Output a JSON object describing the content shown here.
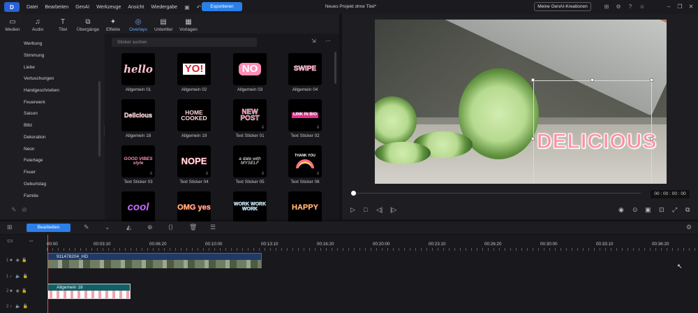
{
  "app": {
    "logo_text": "D",
    "menu": [
      "Datei",
      "Bearbeiten",
      "GenAI",
      "Werkzeuge",
      "Ansicht",
      "Wiedergabe"
    ],
    "export_label": "Exportieren",
    "project_title": "Neues Projekt ohne Titel*",
    "genai_button": "Meine GenAI-Kreationen"
  },
  "tabs": [
    {
      "label": "Medien",
      "icon": "folder-icon"
    },
    {
      "label": "Audio",
      "icon": "music-icon"
    },
    {
      "label": "Titel",
      "icon": "title-icon"
    },
    {
      "label": "Übergänge",
      "icon": "transition-icon"
    },
    {
      "label": "Effekte",
      "icon": "effects-icon"
    },
    {
      "label": "Overlays",
      "icon": "overlay-icon",
      "active": true
    },
    {
      "label": "Untertitel",
      "icon": "subtitle-icon"
    },
    {
      "label": "Vorlagen",
      "icon": "template-icon"
    }
  ],
  "categories": [
    "Werbung",
    "Stimmung",
    "Liebe",
    "Vertuschungen",
    "Handgeschrieben",
    "Feuerwerk",
    "Saison",
    "Blitz",
    "Dekoration",
    "Neon",
    "Feiertage",
    "Feuer",
    "Geburtstag",
    "Familie"
  ],
  "search": {
    "placeholder": "Sticker suchen"
  },
  "stickers": [
    {
      "label": "Allgemein 01",
      "art": "hello"
    },
    {
      "label": "Allgemein 02",
      "art": "YO!"
    },
    {
      "label": "Allgemein 03",
      "art": "NO"
    },
    {
      "label": "Allgemein 04",
      "art": "SWIPE"
    },
    {
      "label": "Allgemein 18",
      "art": "Delicious"
    },
    {
      "label": "Allgemein 19",
      "art": "HOME COOKED"
    },
    {
      "label": "Text Sticker 01",
      "art": "NEW POST"
    },
    {
      "label": "Text Sticker 02",
      "art": "LINK IN BIO"
    },
    {
      "label": "Text Sticker 03",
      "art": "GOOD VIBES style"
    },
    {
      "label": "Text Sticker 04",
      "art": "NOPE"
    },
    {
      "label": "Text Sticker 05",
      "art": "a date with MYSELF"
    },
    {
      "label": "Text Sticker 06",
      "art": "THANK YOU"
    },
    {
      "label": "",
      "art": "cool"
    },
    {
      "label": "",
      "art": "OMG yes"
    },
    {
      "label": "",
      "art": "WORK WORK WORK"
    },
    {
      "label": "",
      "art": "HAPPY"
    }
  ],
  "preview": {
    "overlay_text": "DELICIOUS",
    "timecode": "00 : 00 : 00 : 00"
  },
  "timeline": {
    "edit_button": "Bearbeiten",
    "ruler": [
      "00:00",
      "00:03:10",
      "00:06:20",
      "00:10:00",
      "00:13:10",
      "00:16:20",
      "00:20:00",
      "00:23:10",
      "00:26:20",
      "00:30:00",
      "00:33:10",
      "00:36:20"
    ],
    "video_clip": "911478204_HD",
    "sticker_clip": "Allgemein 18",
    "track_numbers": [
      "1",
      "1",
      "2",
      "2"
    ]
  },
  "colors": {
    "accent": "#2b7fe8",
    "active_tab": "#6aa6ff",
    "playhead": "#e05050"
  }
}
